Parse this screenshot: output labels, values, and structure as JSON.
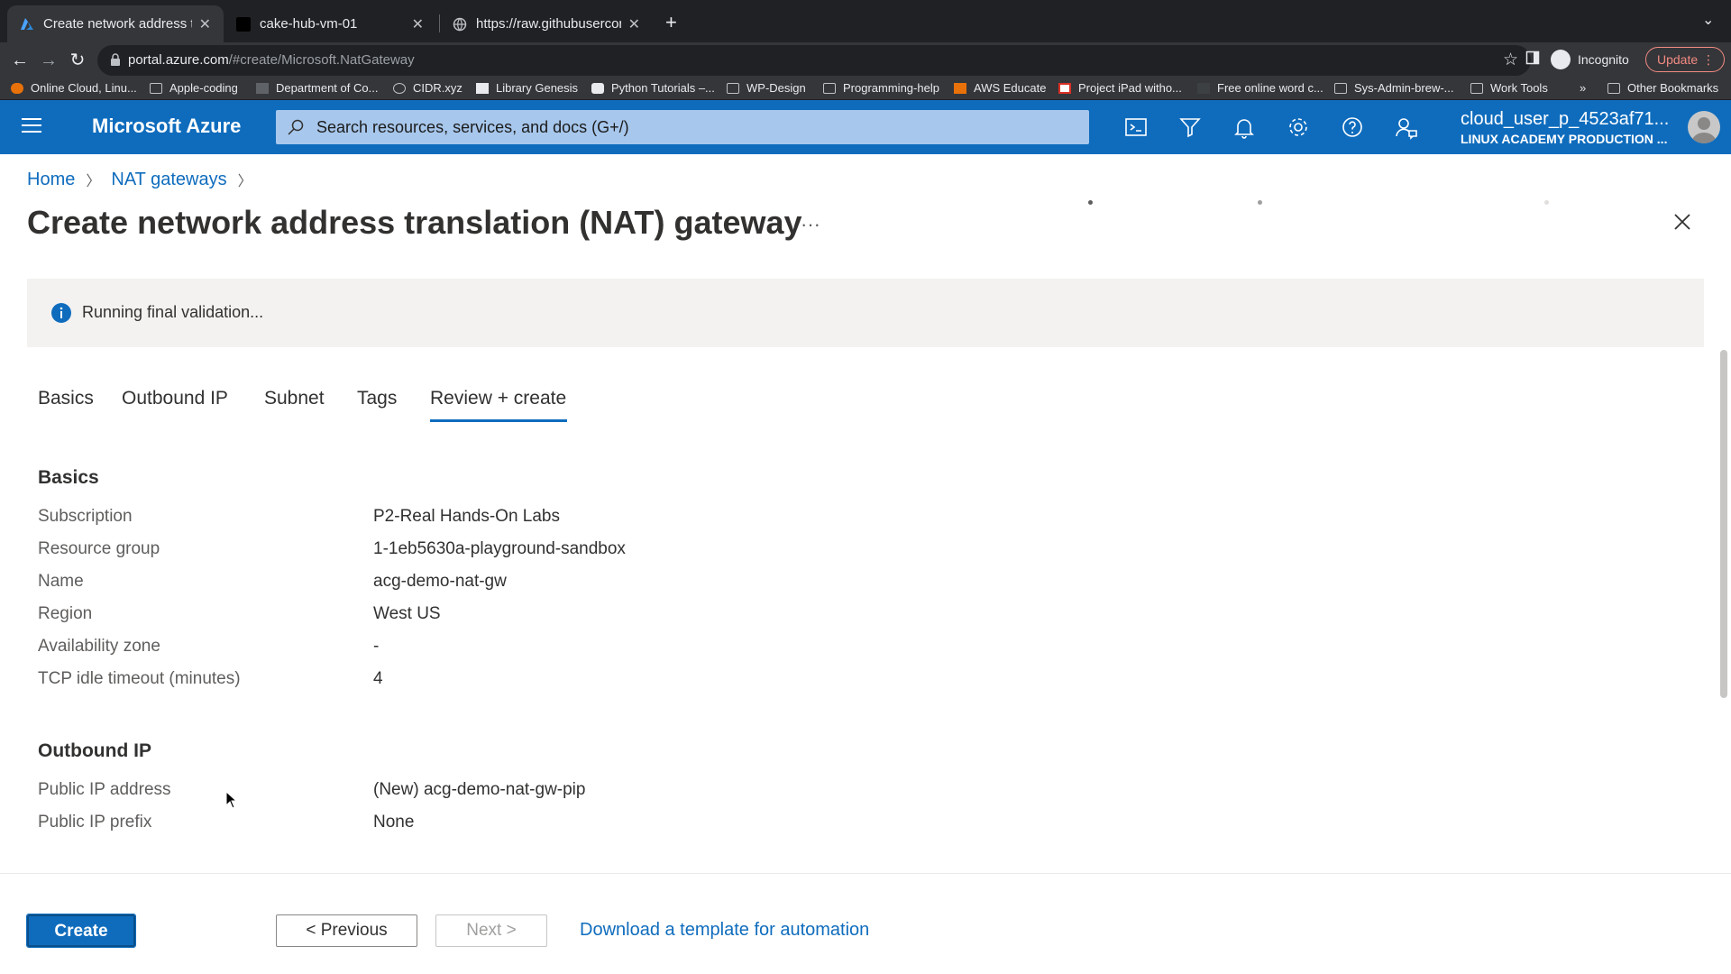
{
  "browser": {
    "tabs": [
      {
        "title": "Create network address transla",
        "active": true,
        "favicon": "azure-icon"
      },
      {
        "title": "cake-hub-vm-01",
        "active": false,
        "favicon": "terminal-icon"
      },
      {
        "title": "https://raw.githubusercontent.",
        "active": false,
        "favicon": "globe-icon"
      }
    ],
    "new_tab_label": "+",
    "url_host": "portal.azure.com",
    "url_path": "/#create/Microsoft.NatGateway",
    "incognito_label": "Incognito",
    "update_label": "Update",
    "bookmarks": [
      {
        "label": "Online Cloud, Linu...",
        "icon": "cloud-icon"
      },
      {
        "label": "Apple-coding",
        "icon": "folder-icon"
      },
      {
        "label": "Department of Co...",
        "icon": "site-icon"
      },
      {
        "label": "CIDR.xyz",
        "icon": "globe-icon"
      },
      {
        "label": "Library Genesis",
        "icon": "book-icon"
      },
      {
        "label": "Python Tutorials –...",
        "icon": "python-icon"
      },
      {
        "label": "WP-Design",
        "icon": "folder-icon"
      },
      {
        "label": "Programming-help",
        "icon": "folder-icon"
      },
      {
        "label": "AWS Educate",
        "icon": "aws-icon"
      },
      {
        "label": "Project iPad witho...",
        "icon": "doc-icon"
      },
      {
        "label": "Free online word c...",
        "icon": "site-icon"
      },
      {
        "label": "Sys-Admin-brew-...",
        "icon": "folder-icon"
      },
      {
        "label": "Work Tools",
        "icon": "folder-icon"
      },
      {
        "label": "»",
        "icon": "more-icon"
      },
      {
        "label": "Other Bookmarks",
        "icon": "folder-icon"
      }
    ]
  },
  "header": {
    "brand": "Microsoft Azure",
    "search_placeholder": "Search resources, services, and docs (G+/)",
    "account_name": "cloud_user_p_4523af71...",
    "account_tenant": "LINUX ACADEMY PRODUCTION ..."
  },
  "breadcrumb": {
    "home": "Home",
    "nat": "NAT gateways"
  },
  "page": {
    "title": "Create network address translation (NAT) gateway",
    "more": "···",
    "validation": "Running final validation..."
  },
  "wizard_tabs": [
    "Basics",
    "Outbound IP",
    "Subnet",
    "Tags",
    "Review + create"
  ],
  "sections": {
    "basics": {
      "heading": "Basics",
      "rows": [
        {
          "label": "Subscription",
          "value": "P2-Real Hands-On Labs"
        },
        {
          "label": "Resource group",
          "value": "1-1eb5630a-playground-sandbox"
        },
        {
          "label": "Name",
          "value": "acg-demo-nat-gw"
        },
        {
          "label": "Region",
          "value": "West US"
        },
        {
          "label": "Availability zone",
          "value": "-"
        },
        {
          "label": "TCP idle timeout (minutes)",
          "value": "4"
        }
      ]
    },
    "outbound": {
      "heading": "Outbound IP",
      "rows": [
        {
          "label": "Public IP address",
          "value": "(New) acg-demo-nat-gw-pip"
        },
        {
          "label": "Public IP prefix",
          "value": "None"
        }
      ]
    }
  },
  "footer": {
    "create": "Create",
    "previous": "< Previous",
    "next": "Next >",
    "download": "Download a template for automation"
  },
  "colors": {
    "azure_blue": "#0f6cbd",
    "chrome_dark": "#202124"
  }
}
